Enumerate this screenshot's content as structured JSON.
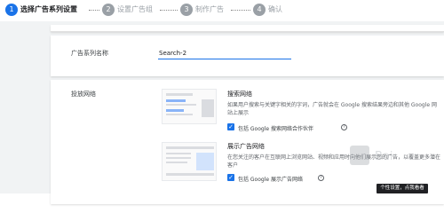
{
  "stepper": {
    "steps": [
      {
        "number": "1",
        "label": "选择广告系列设置",
        "active": true
      },
      {
        "number": "2",
        "label": "设置广告组",
        "active": false
      },
      {
        "number": "3",
        "label": "制作广告",
        "active": false
      },
      {
        "number": "4",
        "label": "确认",
        "active": false
      }
    ]
  },
  "campaign_name": {
    "label": "广告系列名称",
    "value": "Search-2"
  },
  "networks": {
    "label": "投放网络",
    "search": {
      "title": "搜索网络",
      "description": "如果用户搜索与关键字相关的字词，广告就会在 Google 搜索结果旁边和其他 Google 网站上展示",
      "checkbox_label": "包括 Google 搜索网络合作伙伴",
      "checked": true
    },
    "display": {
      "title": "展示广告网络",
      "description": "在您关注的客户在互联网上浏览网站、视频和应用时向他们展示您的广告，以覆盖更多潜在客户",
      "checkbox_label": "包括 Google 展示广告网络",
      "checked": true
    }
  },
  "tooltip": {
    "text": "个性设置，点我看看"
  },
  "colors": {
    "accent": "#1a73e8",
    "inactive": "#9aa0a6",
    "background": "#f1f3f4"
  },
  "icons": {
    "checkbox": "check-icon",
    "help": "help-circle-icon"
  }
}
